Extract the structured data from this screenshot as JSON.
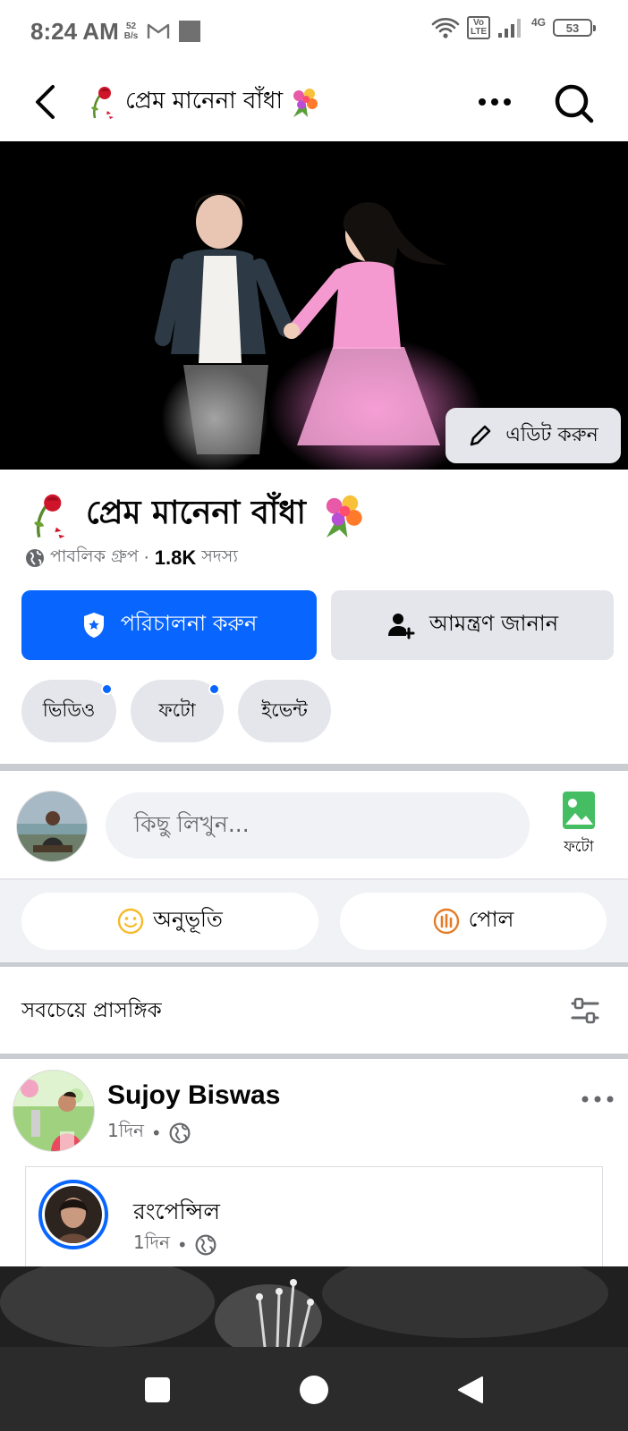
{
  "status_bar": {
    "time": "8:24 AM",
    "speed_value": "52",
    "speed_unit": "B/s",
    "battery": "53",
    "network": "4G",
    "volte": "Vo LTE"
  },
  "header": {
    "title": "প্রেম মানেনা বাঁধা"
  },
  "cover": {
    "edit_label": "এডিট করুন"
  },
  "group": {
    "name": "প্রেম মানেনা বাঁধা",
    "privacy": "পাবলিক গ্রুপ",
    "separator": "·",
    "member_count": "1.8K",
    "member_label": "সদস্য",
    "manage_label": "পরিচালনা করুন",
    "invite_label": "আমন্ত্রণ জানান",
    "chips": [
      {
        "label": "ভিডিও",
        "has_dot": true
      },
      {
        "label": "ফটো",
        "has_dot": true
      },
      {
        "label": "ইভেন্ট",
        "has_dot": false
      }
    ]
  },
  "composer": {
    "placeholder": "কিছু লিখুন...",
    "photo_label": "ফটো",
    "feeling_label": "অনুভূতি",
    "poll_label": "পোল"
  },
  "feed": {
    "sort_label": "সবচেয়ে প্রাসঙ্গিক"
  },
  "post": {
    "author": "Sujoy Biswas",
    "time": "1দিন",
    "dot": "•",
    "shared": {
      "name": "রংপেন্সিল",
      "time": "1দিন",
      "dot": "•"
    }
  },
  "colors": {
    "primary": "#0866ff",
    "secondary_bg": "#e4e6eb",
    "photo_green": "#45bd62",
    "feeling_yellow": "#f7b928",
    "poll_orange": "#e47c27"
  }
}
